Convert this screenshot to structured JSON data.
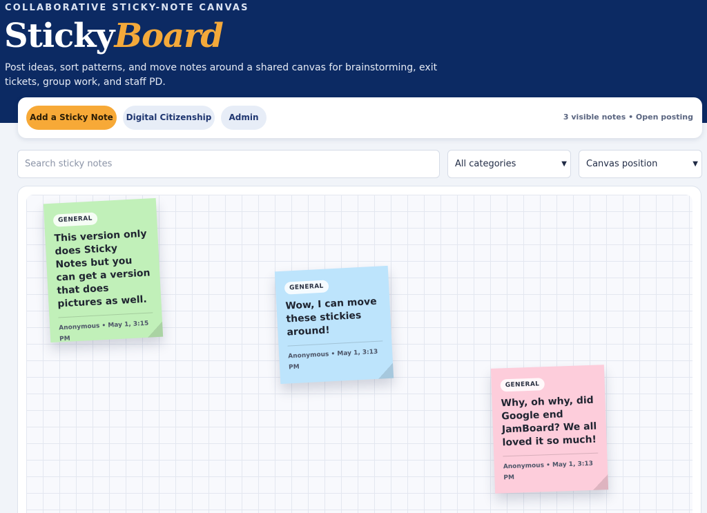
{
  "header": {
    "eyebrow": "COLLABORATIVE STICKY-NOTE CANVAS",
    "brand_part1": "Sticky",
    "brand_part2": "Board",
    "tagline": "Post ideas, sort patterns, and move notes around a shared canvas for brainstorming, exit tickets, group work, and staff PD."
  },
  "toolbar": {
    "add_label": "Add a Sticky Note",
    "tabs": [
      {
        "label": "Digital Citizenship"
      },
      {
        "label": "Admin"
      }
    ],
    "status": "3 visible notes • Open posting"
  },
  "filters": {
    "search_placeholder": "Search sticky notes",
    "category_selected": "All categories",
    "sort_selected": "Canvas position"
  },
  "colors": {
    "header_bg": "#0c2a63",
    "accent": "#f7a937",
    "note_green": "#c1f0b9",
    "note_blue": "#bde4fc",
    "note_pink": "#fdcddb"
  },
  "notes": [
    {
      "tag": "GENERAL",
      "text": "This version only does Sticky Notes but you can get a version that does pictures as well.",
      "meta": "Anonymous • May 1, 3:15 PM",
      "color": "green"
    },
    {
      "tag": "GENERAL",
      "text": "Wow, I can move these stickies around!",
      "meta": "Anonymous • May 1, 3:13 PM",
      "color": "blue"
    },
    {
      "tag": "GENERAL",
      "text": "Why, oh why, did Google end JamBoard? We all loved it so much!",
      "meta": "Anonymous • May 1, 3:13 PM",
      "color": "pink"
    }
  ]
}
